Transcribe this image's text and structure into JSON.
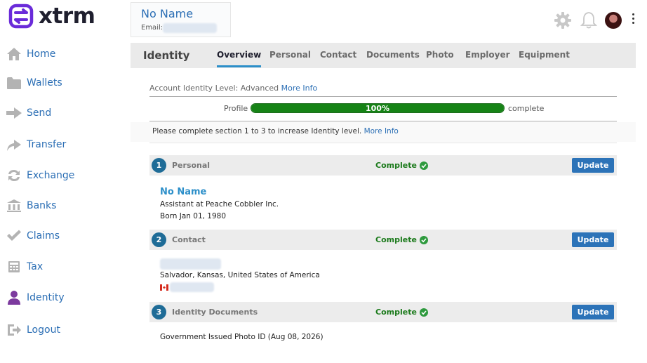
{
  "brand": {
    "name": "xtrm",
    "color": "#6a2bd9"
  },
  "sidebar": {
    "items": [
      {
        "label": "Home",
        "icon": "home-icon"
      },
      {
        "label": "Wallets",
        "icon": "folder-icon"
      },
      {
        "label": "Send",
        "icon": "arrow-right-icon"
      },
      {
        "label": "Transfer",
        "icon": "transfer-icon"
      },
      {
        "label": "Exchange",
        "icon": "exchange-icon"
      },
      {
        "label": "Banks",
        "icon": "bank-icon"
      },
      {
        "label": "Claims",
        "icon": "check-icon"
      },
      {
        "label": "Tax",
        "icon": "calculator-icon"
      },
      {
        "label": "Identity",
        "icon": "person-icon"
      },
      {
        "label": "Logout",
        "icon": "logout-icon"
      }
    ]
  },
  "header": {
    "user_name": "No Name",
    "email_label": "Email:",
    "icons": [
      "gear-icon",
      "bell-icon",
      "avatar",
      "kebab-menu-icon"
    ]
  },
  "tabbar": {
    "title": "Identity",
    "tabs": [
      {
        "label": "Overview",
        "active": true
      },
      {
        "label": "Personal",
        "active": false
      },
      {
        "label": "Contact",
        "active": false
      },
      {
        "label": "Documents",
        "active": false
      },
      {
        "label": "Photo",
        "active": false
      },
      {
        "label": "Employer",
        "active": false
      },
      {
        "label": "Equipment",
        "active": false
      }
    ]
  },
  "level": {
    "text": "Account Identity Level: Advanced",
    "more_info": "More Info",
    "profile_label": "Profile",
    "progress_pct": 100,
    "progress_text": "100%",
    "complete_label": "complete",
    "notice": "Please complete section 1 to 3 to increase Identity level.",
    "notice_link": "More Info"
  },
  "sections": [
    {
      "num": "1",
      "title": "Personal",
      "status": "Complete",
      "button": "Update",
      "name": "No Name",
      "lines": [
        "Assistant at Peache Cobbler Inc.",
        "Born Jan 01, 1980"
      ]
    },
    {
      "num": "2",
      "title": "Contact",
      "status": "Complete",
      "button": "Update",
      "lines": [
        "Salvador, Kansas, United States of America"
      ]
    },
    {
      "num": "3",
      "title": "Identity Documents",
      "status": "Complete",
      "button": "Update",
      "lines": [
        "Government Issued Photo ID (Aug 08, 2026)"
      ]
    }
  ],
  "colors": {
    "link": "#2c6fb5",
    "success": "#1b7a1b",
    "progress": "#168316",
    "button": "#2c73b8",
    "section_number": "#1f6c97"
  }
}
